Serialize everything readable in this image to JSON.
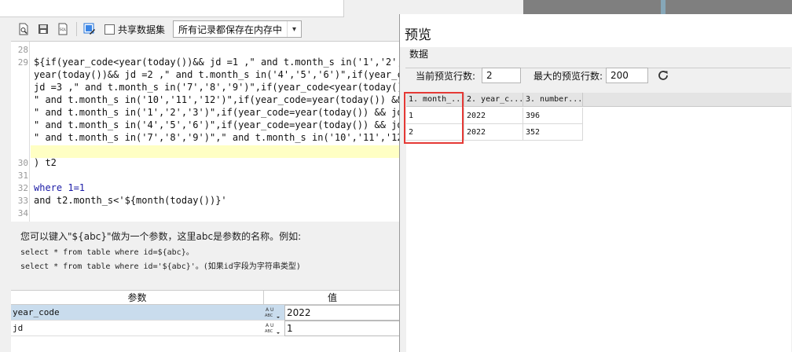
{
  "toolbar": {
    "share_label": "共享数据集",
    "cache_option": "所有记录都保存在内存中"
  },
  "editor": {
    "line_numbers": [
      "28",
      "29",
      "",
      "",
      "",
      "",
      "",
      "",
      "",
      "30",
      "31",
      "32",
      "33",
      "34",
      "35"
    ],
    "lines": [
      "",
      "${if(year_code<year(today())&& jd =1 ,\" and t.month_s in('1','2','3",
      "year(today())&& jd =2 ,\" and t.month_s in('4','5','6')\",if(year_cod",
      "jd =3 ,\" and t.month_s in('7','8','9')\",if(year_code<year(today())&",
      "\" and t.month_s in('10','11','12')\",if(year_code=year(today()) && j",
      "\" and t.month_s in('1','2','3')\",if(year_code=year(today()) && jd =",
      "\" and t.month_s in('4','5','6')\",if(year_code=year(today()) && jd =",
      "\" and t.month_s in('7','8','9')\",\" and t.month_s in('10','11','12')",
      "",
      ") t2",
      "",
      "where 1=1",
      "and t2.month_s<'${month(today())}'",
      ""
    ]
  },
  "help": {
    "line1": "您可以键入\"${abc}\"做为一个参数，这里abc是参数的名称。例如:",
    "line2": "select * from table where id=${abc}。",
    "line3": "select * from table where id='${abc}'。(如果id字段为字符串类型)"
  },
  "params": {
    "header_name": "参数",
    "header_value": "值",
    "rows": [
      {
        "name": "year_code",
        "type": "ABC",
        "value": "2022"
      },
      {
        "name": "jd",
        "type": "ABC",
        "value": "1"
      }
    ]
  },
  "preview": {
    "title": "预览",
    "group_label": "数据",
    "current_rows_label": "当前预览行数:",
    "current_rows_value": "2",
    "max_rows_label": "最大的预览行数:",
    "max_rows_value": "200",
    "columns": [
      "1. month_...",
      "2. year_c...",
      "3. number..."
    ],
    "rows": [
      [
        "1",
        "2022",
        "396"
      ],
      [
        "2",
        "2022",
        "352"
      ]
    ]
  },
  "colors": {
    "highlight_box": "#e53935",
    "current_line": "#ffffc4",
    "param_selected_row": "#c9dced"
  }
}
